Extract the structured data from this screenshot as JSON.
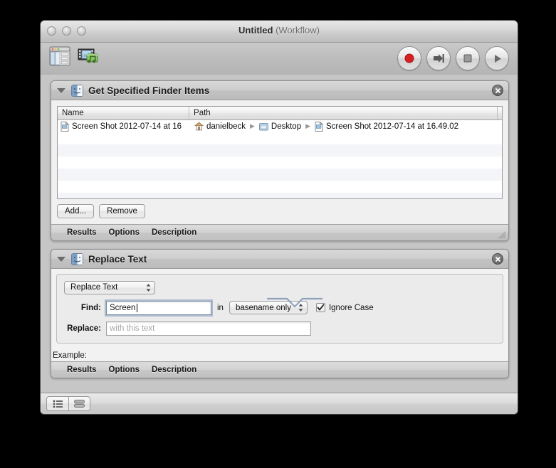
{
  "window": {
    "title": "Untitled",
    "subtitle": "(Workflow)"
  },
  "toolbar": {
    "library_icon": "library-icon",
    "media_icon": "media-icon",
    "record_label": "record-button",
    "step_label": "step-button",
    "stop_label": "stop-button",
    "run_label": "run-button"
  },
  "actions": [
    {
      "title": "Get Specified Finder Items",
      "icon": "finder-icon",
      "close_icon": "close-icon",
      "table": {
        "columns": [
          "Name",
          "Path"
        ],
        "rows": [
          {
            "name": "Screen Shot 2012-07-14 at 16",
            "path": [
              "danielbeck",
              "Desktop",
              "Screen Shot 2012-07-14 at 16.49.02"
            ]
          }
        ]
      },
      "buttons": [
        {
          "label": "Add..."
        },
        {
          "label": "Remove"
        }
      ],
      "tabs": [
        "Results",
        "Options",
        "Description"
      ]
    },
    {
      "title": "Replace Text",
      "icon": "finder-icon",
      "close_icon": "close-icon",
      "mode_popup": {
        "value": "Replace Text"
      },
      "find": {
        "label": "Find:",
        "value": "Screen ",
        "in_label": "in",
        "scope_popup": {
          "value": "basename only"
        },
        "ignore_case": {
          "label": "Ignore Case",
          "checked": true
        }
      },
      "replace": {
        "label": "Replace:",
        "value": "",
        "placeholder": "with this text"
      },
      "example_label": "Example:",
      "tabs": [
        "Results",
        "Options",
        "Description"
      ]
    }
  ],
  "statusbar": {
    "view_list_icon": "list-view-icon",
    "view_group_icon": "group-view-icon"
  }
}
